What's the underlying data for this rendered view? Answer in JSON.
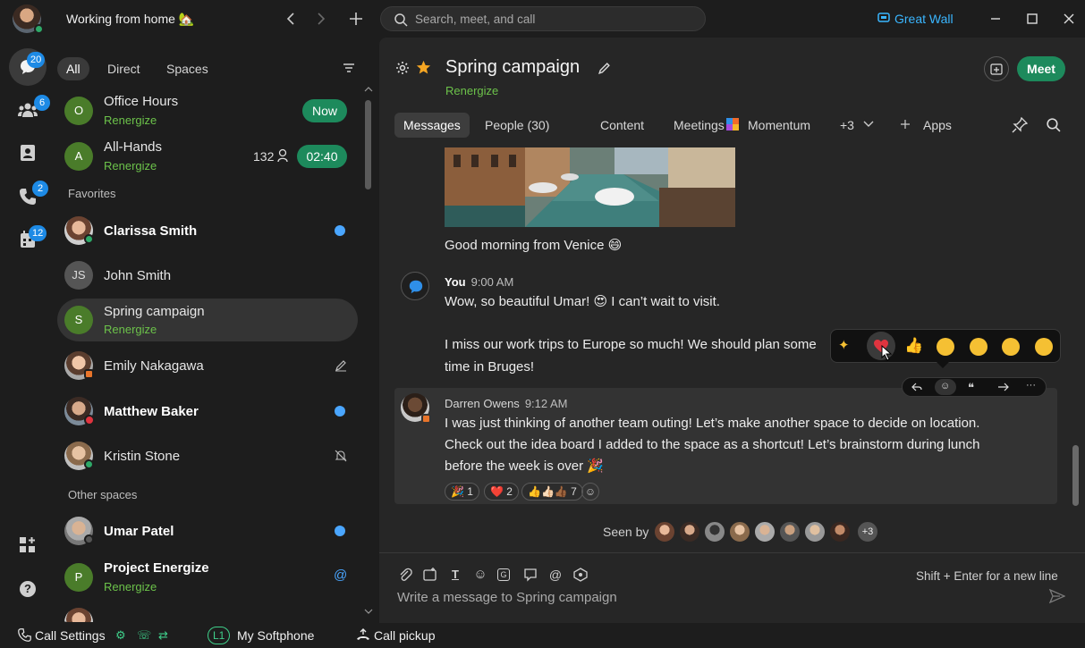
{
  "topbar": {
    "status": "Working from home 🏡",
    "search_placeholder": "Search, meet, and call",
    "org_name": "Great Wall"
  },
  "rail": {
    "messages_badge": "20",
    "teams_badge": "6",
    "calls_badge": "2",
    "meetings_badge": "12"
  },
  "filters": {
    "all": "All",
    "direct": "Direct",
    "spaces": "Spaces"
  },
  "list": {
    "office_hours": {
      "initial": "O",
      "title": "Office Hours",
      "sub": "Renergize",
      "pill": "Now"
    },
    "all_hands": {
      "initial": "A",
      "title": "All-Hands",
      "sub": "Renergize",
      "count": "132",
      "pill": "02:40"
    },
    "favorites_label": "Favorites",
    "clarissa": {
      "title": "Clarissa Smith"
    },
    "john": {
      "initial": "JS",
      "title": "John Smith"
    },
    "spring": {
      "initial": "S",
      "title": "Spring campaign",
      "sub": "Renergize"
    },
    "emily": {
      "title": "Emily Nakagawa"
    },
    "matthew": {
      "title": "Matthew Baker"
    },
    "kristin": {
      "title": "Kristin Stone"
    },
    "other_label": "Other spaces",
    "umar": {
      "title": "Umar Patel"
    },
    "project": {
      "initial": "P",
      "title": "Project Energize",
      "sub": "Renergize"
    }
  },
  "bottombar": {
    "call_settings": "Call Settings",
    "line": "L1",
    "softphone": "My Softphone",
    "pickup": "Call pickup"
  },
  "space": {
    "title": "Spring campaign",
    "sub": "Renergize",
    "meet": "Meet",
    "tabs": {
      "messages": "Messages",
      "people": "People (30)",
      "content": "Content",
      "meetings": "Meetings",
      "momentum": "Momentum",
      "more": "+3",
      "apps": "Apps"
    }
  },
  "messages": {
    "venice": "Good morning from Venice 😄",
    "you_name": "You",
    "you_time": "9:00 AM",
    "you_line1": "Wow, so beautiful Umar! 😍 I can’t wait to visit.",
    "you_line2": "I miss our work trips to Europe so much! We should plan some",
    "you_line3": "time in Bruges!",
    "darren_name": "Darren Owens",
    "darren_time": "9:12 AM",
    "darren_line1": "I was just thinking of another team outing! Let’s make another space to decide on location.",
    "darren_line2": "Check out the idea board I added to the space as a shortcut! Let’s brainstorm during lunch",
    "darren_line3": "before the week is over 🎉",
    "reactions": [
      "🎉 1",
      "❤️ 2",
      "👍👍🏻👍🏾 7"
    ],
    "seen_by": "Seen by",
    "seen_more": "+3"
  },
  "composer": {
    "hint": "Shift + Enter for a new line",
    "placeholder": "Write a message to Spring campaign"
  }
}
